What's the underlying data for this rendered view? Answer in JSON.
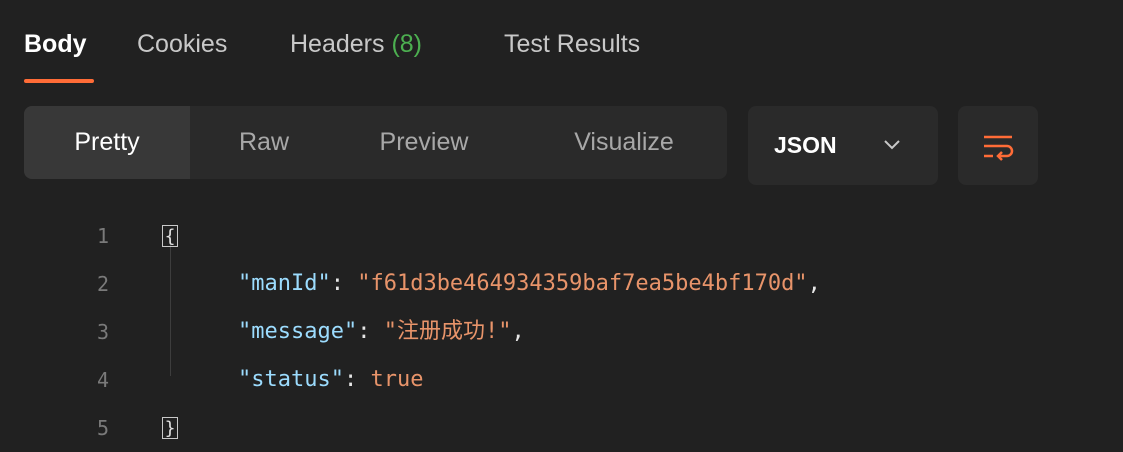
{
  "tabs": {
    "body": "Body",
    "cookies": "Cookies",
    "headers": "Headers",
    "headers_count": "(8)",
    "test_results": "Test Results"
  },
  "format_tabs": {
    "pretty": "Pretty",
    "raw": "Raw",
    "preview": "Preview",
    "visualize": "Visualize"
  },
  "language": {
    "selected": "JSON"
  },
  "icons": {
    "chevron": "chevron-down-icon",
    "wrap": "wrap-lines-icon"
  },
  "colors": {
    "accent": "#ff6c37",
    "count_green": "#4caf50",
    "key": "#9cdcfe",
    "string": "#e8946a"
  },
  "editor": {
    "line_numbers": [
      "1",
      "2",
      "3",
      "4",
      "5"
    ],
    "open_brace": "{",
    "close_brace": "}",
    "lines": [
      {
        "key": "\"manId\"",
        "sep": ": ",
        "value": "\"f61d3be464934359baf7ea5be4bf170d\"",
        "trail": ","
      },
      {
        "key": "\"message\"",
        "sep": ": ",
        "value": "\"注册成功!\"",
        "trail": ","
      },
      {
        "key": "\"status\"",
        "sep": ": ",
        "value": "true",
        "trail": ""
      }
    ]
  }
}
